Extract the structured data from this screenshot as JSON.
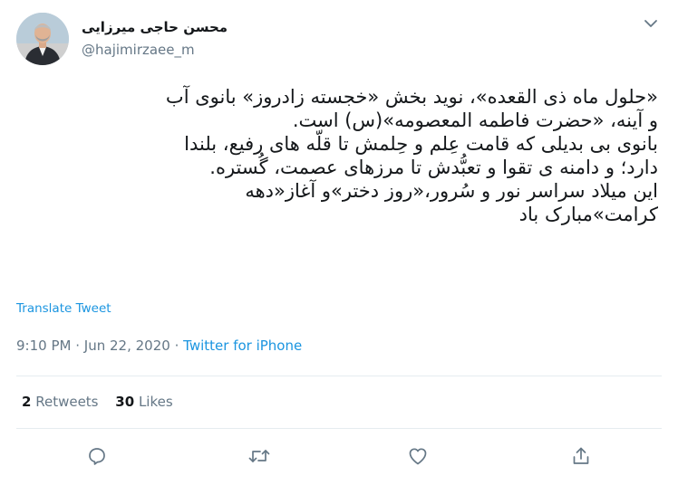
{
  "user": {
    "display_name": "محسن حاجی میرزایی",
    "handle": "@hajimirzaee_m"
  },
  "tweet": {
    "lines": [
      "«حلول ماه ذی القعده»، نوید بخش «خجسته زادروز» بانوی آب",
      "و آینه، «حضرت فاطمه المعصومه»(س) است.",
      "بانوی بی بدیلی که قامت عِلم و حِلمش تا قلّه های رفیع، بلندا",
      "دارد؛ و دامنه ی تقوا و تعبُّدش تا مرزهای عصمت، گُستره.",
      "این میلاد سراسر نور و سُرور،«روز دختر»و آغاز«دهه",
      "کرامت»مبارک باد"
    ],
    "translate_label": "Translate Tweet",
    "time": "9:10 PM",
    "separator": "·",
    "date": "Jun 22, 2020",
    "source": "Twitter for iPhone"
  },
  "stats": {
    "retweets_count": "2",
    "retweets_label": "Retweets",
    "likes_count": "30",
    "likes_label": "Likes"
  },
  "icons": {
    "more": "chevron-down-icon",
    "reply": "reply-icon",
    "retweet": "retweet-icon",
    "like": "heart-icon",
    "share": "share-icon"
  },
  "colors": {
    "link": "#1b95e0",
    "text": "#14171a",
    "secondary": "#657786",
    "divider": "#e6ecf0",
    "icon": "#657786"
  }
}
